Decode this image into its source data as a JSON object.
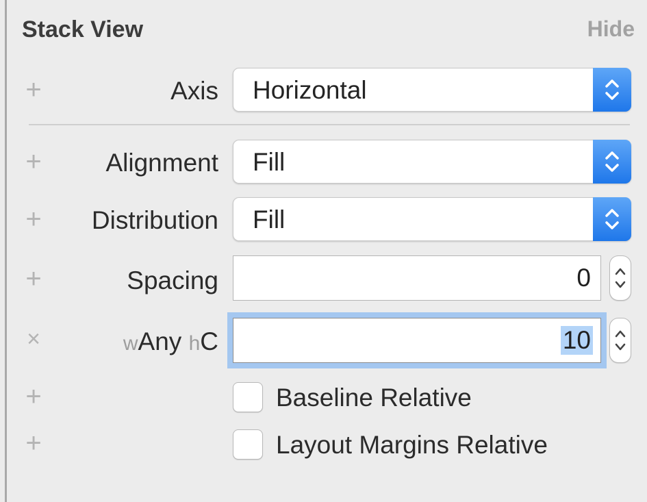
{
  "header": {
    "title": "Stack View",
    "hide_label": "Hide"
  },
  "icons": {
    "plus": "+",
    "close": "×"
  },
  "rows": {
    "axis": {
      "label": "Axis",
      "value": "Horizontal"
    },
    "alignment": {
      "label": "Alignment",
      "value": "Fill"
    },
    "distribution": {
      "label": "Distribution",
      "value": "Fill"
    },
    "spacing": {
      "label": "Spacing",
      "value": "0"
    },
    "spacing_variation": {
      "w_prefix": "w",
      "w_value": "Any",
      "h_prefix": "h",
      "h_value": "C",
      "value": "10"
    },
    "baseline_relative": {
      "label": "Baseline Relative",
      "checked": false
    },
    "layout_margins_relative": {
      "label": "Layout Margins Relative",
      "checked": false
    }
  },
  "colors": {
    "accent": "#1f77ea",
    "focus_ring": "#a4c7f0",
    "selection": "#b3d4f8"
  }
}
